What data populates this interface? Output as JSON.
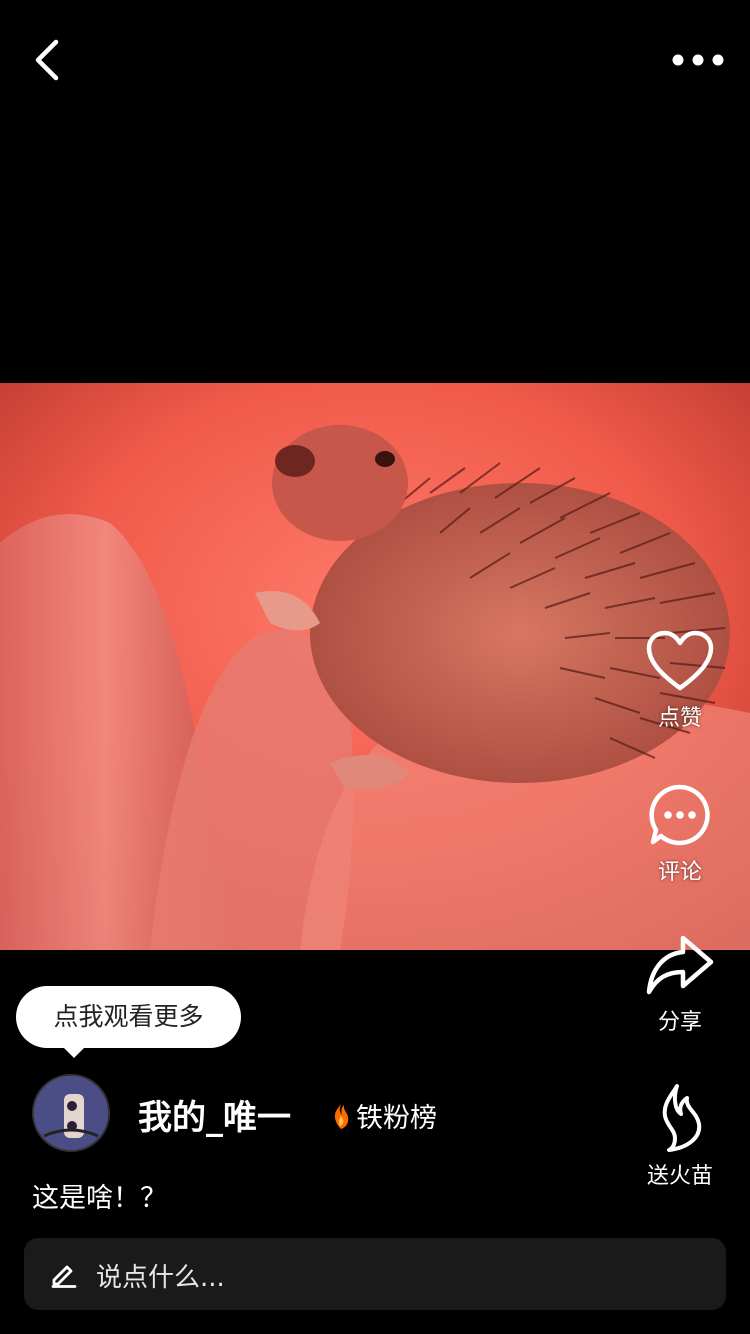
{
  "topbar": {
    "back_icon": "chevron-left-icon",
    "more_icon": "more-dots-icon"
  },
  "video": {
    "subject": "hedgehog-in-hand",
    "tint": "#ff4d3d"
  },
  "actions": [
    {
      "id": "like",
      "label": "点赞",
      "icon": "heart-icon"
    },
    {
      "id": "comment",
      "label": "评论",
      "icon": "comment-bubble-icon"
    },
    {
      "id": "share",
      "label": "分享",
      "icon": "share-arrow-icon"
    },
    {
      "id": "gift",
      "label": "送火苗",
      "icon": "flame-icon"
    }
  ],
  "tooltip": {
    "text": "点我观看更多"
  },
  "author": {
    "name": "我的_唯一",
    "fan_rank_label": "铁粉榜",
    "fan_rank_icon": "fire-icon"
  },
  "caption": "这是啥！？",
  "comment_input": {
    "placeholder": "说点什么...",
    "icon": "pencil-icon"
  },
  "colors": {
    "background": "#000000",
    "text": "#ffffff",
    "input_bg": "#1a1a1a",
    "flame_orange": "#ff6a00"
  }
}
